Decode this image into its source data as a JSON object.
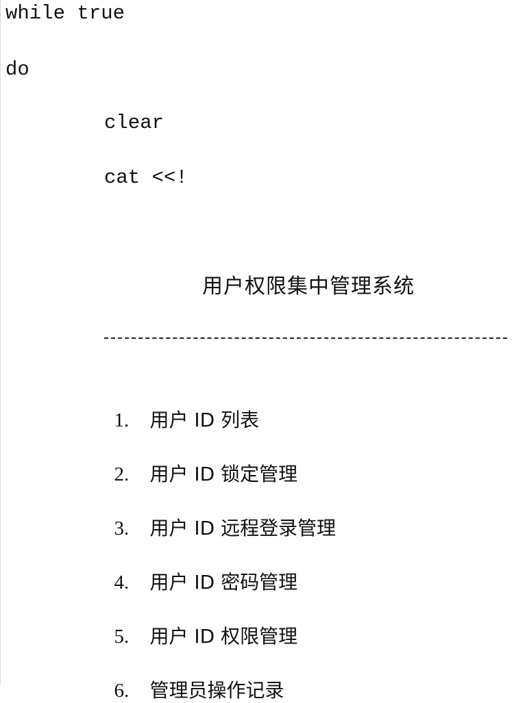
{
  "code": {
    "line1": "while true",
    "line2": "do",
    "line3": "clear",
    "line4": "cat <<!"
  },
  "menu": {
    "title": "用户权限集中管理系统",
    "items": [
      {
        "number": "1.",
        "label": "用户 ID 列表"
      },
      {
        "number": "2.",
        "label": "用户 ID 锁定管理"
      },
      {
        "number": "3.",
        "label": "用户 ID 远程登录管理"
      },
      {
        "number": "4.",
        "label": "用户 ID 密码管理"
      },
      {
        "number": "5.",
        "label": "用户 ID 权限管理"
      },
      {
        "number": "6.",
        "label": "管理员操作记录"
      }
    ]
  }
}
